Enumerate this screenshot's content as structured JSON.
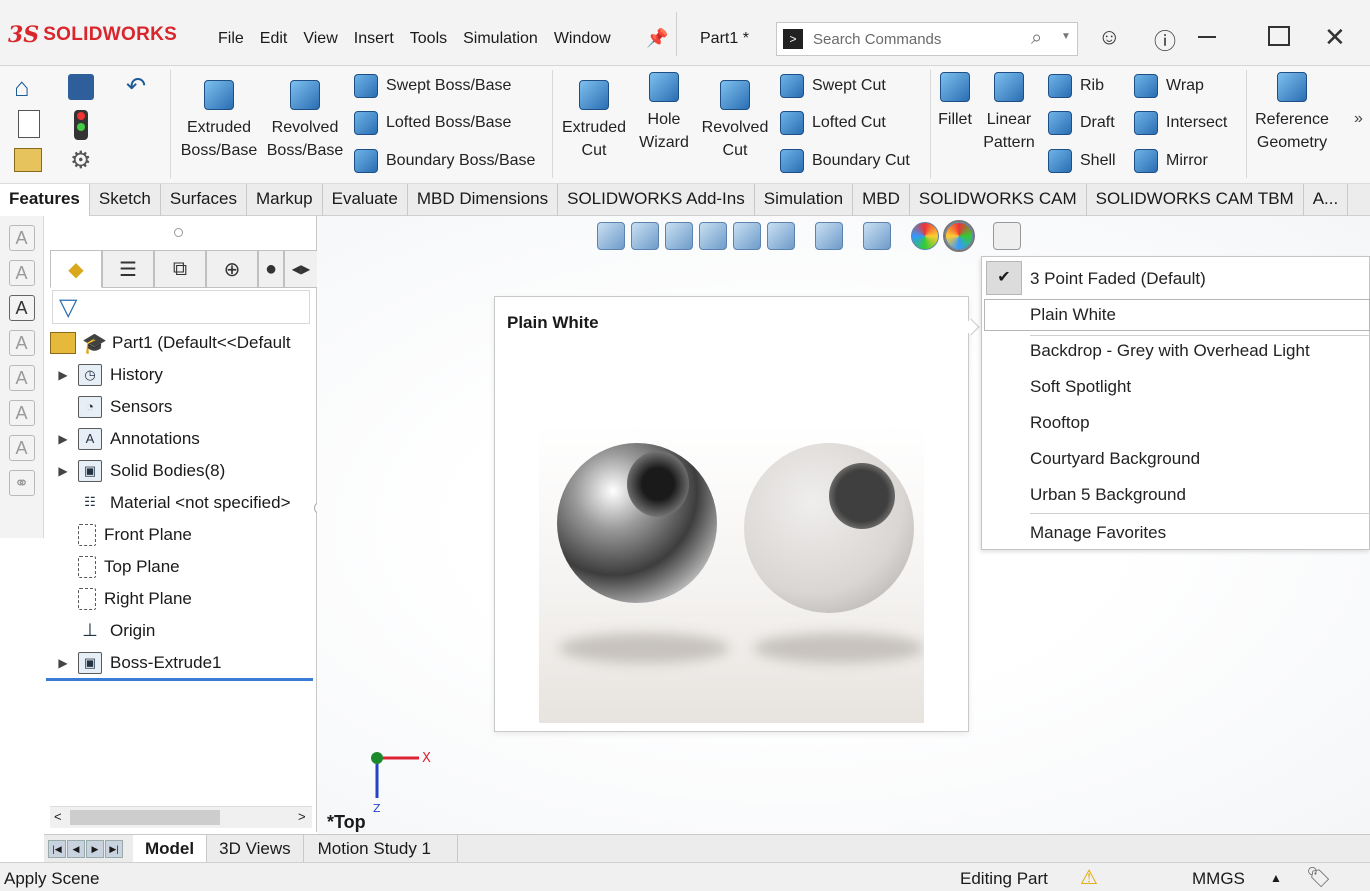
{
  "app": {
    "brand": "SOLIDWORKS",
    "menu": [
      "File",
      "Edit",
      "View",
      "Insert",
      "Tools",
      "Simulation",
      "Window"
    ],
    "document_title": "Part1 *",
    "search_placeholder": "Search Commands"
  },
  "ribbon": {
    "extruded_boss": "Extruded\nBoss/Base",
    "revolved_boss": "Revolved\nBoss/Base",
    "swept_boss": "Swept Boss/Base",
    "lofted_boss": "Lofted Boss/Base",
    "boundary_boss": "Boundary Boss/Base",
    "extruded_cut": "Extruded\nCut",
    "hole_wizard": "Hole\nWizard",
    "revolved_cut": "Revolved\nCut",
    "swept_cut": "Swept Cut",
    "lofted_cut": "Lofted Cut",
    "boundary_cut": "Boundary Cut",
    "fillet": "Fillet",
    "linear_pattern": "Linear\nPattern",
    "rib": "Rib",
    "draft": "Draft",
    "shell": "Shell",
    "wrap": "Wrap",
    "intersect": "Intersect",
    "mirror": "Mirror",
    "reference_geometry": "Reference\nGeometry"
  },
  "tabs": [
    "Features",
    "Sketch",
    "Surfaces",
    "Markup",
    "Evaluate",
    "MBD Dimensions",
    "SOLIDWORKS Add-Ins",
    "Simulation",
    "MBD",
    "SOLIDWORKS CAM",
    "SOLIDWORKS CAM TBM",
    "A..."
  ],
  "tree": {
    "root": "Part1  (Default<<Default",
    "items": [
      {
        "label": "History",
        "expandable": true
      },
      {
        "label": "Sensors",
        "expandable": false
      },
      {
        "label": "Annotations",
        "expandable": true
      },
      {
        "label": "Solid Bodies(8)",
        "expandable": true
      },
      {
        "label": "Material <not specified>",
        "expandable": false
      },
      {
        "label": "Front Plane",
        "expandable": false
      },
      {
        "label": "Top Plane",
        "expandable": false
      },
      {
        "label": "Right Plane",
        "expandable": false
      },
      {
        "label": "Origin",
        "expandable": false
      },
      {
        "label": "Boss-Extrude1",
        "expandable": true
      }
    ]
  },
  "preview": {
    "title": "Plain White"
  },
  "scene_menu": {
    "checked": "3 Point Faded  (Default)",
    "hovered": "Plain White",
    "items": [
      "Backdrop - Grey with Overhead Light",
      "Soft Spotlight",
      "Rooftop",
      "Courtyard Background",
      "Urban 5 Background"
    ],
    "manage": "Manage Favorites"
  },
  "viewport": {
    "view_label": "*Top",
    "triad_x": "X",
    "triad_z": "Z"
  },
  "bottom_tabs": [
    "Model",
    "3D Views",
    "Motion Study 1"
  ],
  "status": {
    "left": "Apply Scene",
    "mode": "Editing Part",
    "units": "MMGS"
  },
  "colors": {
    "brand": "#d8262c",
    "accent": "#2a6eb3",
    "selection_bar": "#3a7bd5"
  }
}
